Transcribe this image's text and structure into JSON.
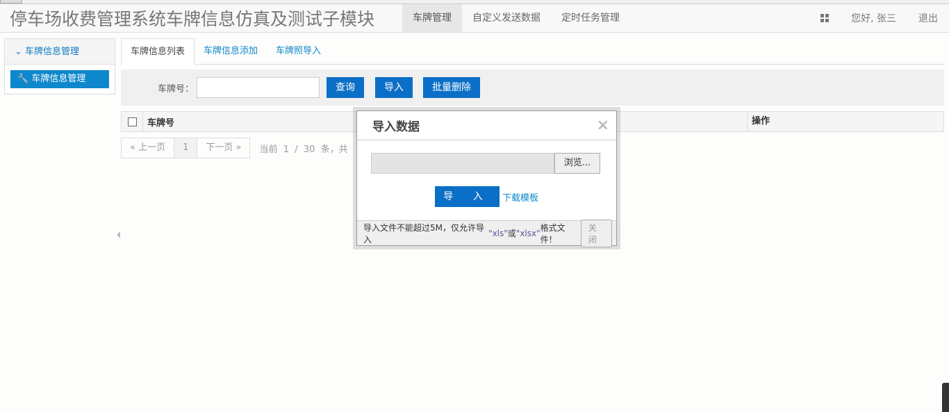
{
  "header": {
    "title": "停车场收费管理系统车牌信息仿真及测试子模块",
    "nav": [
      "车牌管理",
      "自定义发送数据",
      "定时任务管理"
    ],
    "greeting": "您好, 张三",
    "logout": "退出"
  },
  "sidebar": {
    "group": "车牌信息管理",
    "item": "车牌信息管理"
  },
  "tabs": [
    "车牌信息列表",
    "车牌信息添加",
    "车牌照导入"
  ],
  "search": {
    "label": "车牌号：",
    "value": "",
    "query": "查询",
    "import": "导入",
    "batch_delete": "批量删除"
  },
  "table": {
    "columns": [
      "车牌号",
      "操作"
    ]
  },
  "pager": {
    "prev": "« 上一页",
    "page": "1",
    "next": "下一页 »",
    "info": "当前  1  /  30  条，共"
  },
  "modal": {
    "title": "导入数据",
    "browse": "浏览...",
    "import": "导 入",
    "download": "下载模板",
    "footer_pre": "导入文件不能超过5M，仅允许导入",
    "xls": "\"xls\"",
    "or": "或",
    "xlsx": "\"xlsx\"",
    "footer_post": "格式文件！",
    "close": "关闭"
  }
}
